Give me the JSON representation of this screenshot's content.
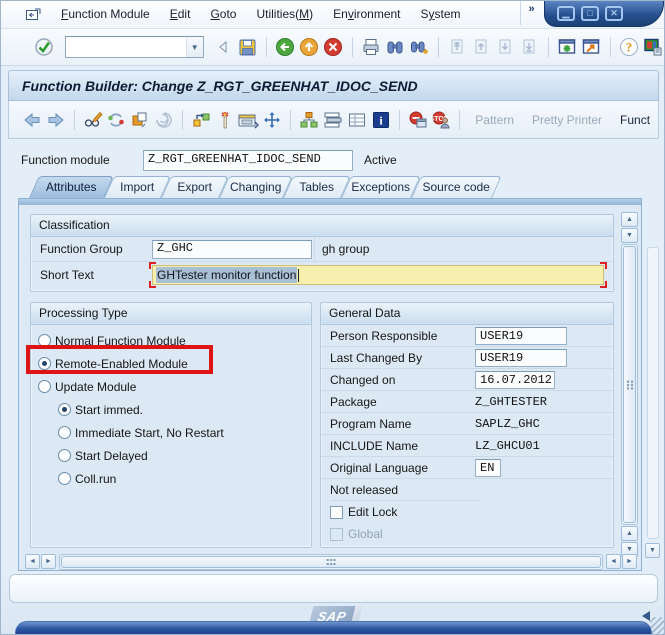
{
  "window": {
    "title": "Function Builder: Change Z_RGT_GREENHAT_IDOC_SEND",
    "overflow_chevron": "»",
    "minimize_glyph": "▁",
    "maximize_glyph": "□",
    "close_glyph": "✕"
  },
  "menu": {
    "items": [
      {
        "pre": "",
        "u": "F",
        "post": "unction Module"
      },
      {
        "pre": "",
        "u": "E",
        "post": "dit"
      },
      {
        "pre": "",
        "u": "G",
        "post": "oto"
      },
      {
        "pre": "Utilities(",
        "u": "M",
        "post": ")"
      },
      {
        "pre": "En",
        "u": "v",
        "post": "ironment"
      },
      {
        "pre": "S",
        "u": "y",
        "post": "stem"
      }
    ]
  },
  "toolbar": {
    "command_value": "",
    "dropdown_glyph": "▼"
  },
  "app_toolbar": {
    "pattern_label": "Pattern",
    "pretty_printer_label": "Pretty Printer",
    "function_doc_label": "Funct"
  },
  "form": {
    "function_module_label": "Function module",
    "function_module_value": "Z_RGT_GREENHAT_IDOC_SEND",
    "status_text": "Active"
  },
  "tabs": [
    {
      "label": "Attributes",
      "active": true
    },
    {
      "label": "Import",
      "active": false
    },
    {
      "label": "Export",
      "active": false
    },
    {
      "label": "Changing",
      "active": false
    },
    {
      "label": "Tables",
      "active": false
    },
    {
      "label": "Exceptions",
      "active": false
    },
    {
      "label": "Source code",
      "active": false
    }
  ],
  "classification": {
    "title": "Classification",
    "function_group_label": "Function Group",
    "function_group_value": "Z_GHC",
    "function_group_text": "gh group",
    "short_text_label": "Short Text",
    "short_text_value": "GHTester monitor function"
  },
  "processing_type": {
    "title": "Processing Type",
    "options": [
      {
        "label": "Normal Function Module",
        "selected": false,
        "indent": false,
        "highlighted": false
      },
      {
        "label": "Remote-Enabled Module",
        "selected": true,
        "indent": false,
        "highlighted": true
      },
      {
        "label": "Update Module",
        "selected": false,
        "indent": false,
        "highlighted": false
      },
      {
        "label": "Start immed.",
        "selected": true,
        "indent": true,
        "highlighted": false
      },
      {
        "label": "Immediate Start, No Restart",
        "selected": false,
        "indent": true,
        "highlighted": false
      },
      {
        "label": "Start Delayed",
        "selected": false,
        "indent": true,
        "highlighted": false
      },
      {
        "label": "Coll.run",
        "selected": false,
        "indent": true,
        "highlighted": false
      }
    ]
  },
  "general_data": {
    "title": "General Data",
    "rows": [
      {
        "label": "Person Responsible",
        "value": "USER19"
      },
      {
        "label": "Last Changed By",
        "value": "USER19"
      },
      {
        "label": "Changed on",
        "value": "16.07.2012"
      },
      {
        "label": "Package",
        "value": "Z_GHTESTER"
      },
      {
        "label": "Program Name",
        "value": "SAPLZ_GHC"
      },
      {
        "label": "INCLUDE Name",
        "value": "LZ_GHCU01"
      },
      {
        "label": "Original Language",
        "value": "EN"
      }
    ],
    "not_released_label": "Not released",
    "checkboxes": [
      {
        "label": "Edit Lock",
        "checked": false,
        "disabled": false
      },
      {
        "label": "Global",
        "checked": false,
        "disabled": true
      }
    ]
  },
  "scroll": {
    "up": "▲",
    "down": "▼",
    "left": "◄",
    "right": "►"
  },
  "footer": {
    "logo_text": "SAP"
  },
  "colors": {
    "annotation_red": "#dd1414",
    "short_text_bg": "#f7efae",
    "selection": "#a9c0d4"
  }
}
